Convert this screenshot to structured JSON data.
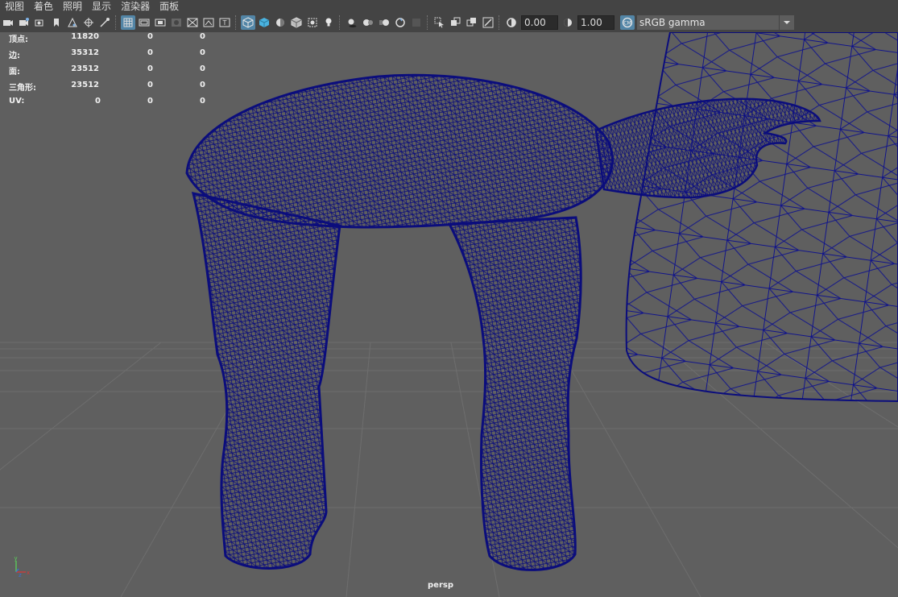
{
  "menus": [
    "视图",
    "着色",
    "照明",
    "显示",
    "渲染器",
    "面板"
  ],
  "toolbar": {
    "groups": [
      [
        "camera-icon",
        "camera-attributes-icon",
        "snapshot-icon",
        "bookmark-icon",
        "image-plane-icon",
        "camera-pivot-icon",
        "dolly-icon"
      ],
      [
        "grid-icon",
        "film-gate-icon",
        "resolution-gate-icon",
        "gate-mask-icon",
        "field-chart-icon",
        "safe-action-icon",
        "safe-title-icon"
      ],
      [
        "wireframe-icon",
        "smooth-shade-icon",
        "default-material-icon",
        "wireframe-on-shaded-icon",
        "xray-icon",
        "use-all-lights-icon"
      ],
      [
        "shadows-icon",
        "ambient-occlusion-icon",
        "motion-blur-icon",
        "multisample-antialias-icon",
        "depth-of-field-icon"
      ],
      [
        "isolate-select-icon",
        "xray-joints-icon",
        "xray-active-icon",
        "backface-culling-icon"
      ]
    ],
    "active": [
      "grid-icon",
      "wireframe-icon"
    ],
    "exposure": "0.00",
    "gamma": "1.00",
    "color_space": "sRGB gamma",
    "color_management_icon": "color-management-icon",
    "dropdown_icon": "chevron-down-icon"
  },
  "hud": {
    "rows": [
      {
        "label": "顶点:",
        "c1": "11820",
        "c2": "0",
        "c3": "0"
      },
      {
        "label": "边:",
        "c1": "35312",
        "c2": "0",
        "c3": "0"
      },
      {
        "label": "面:",
        "c1": "23512",
        "c2": "0",
        "c3": "0"
      },
      {
        "label": "三角形:",
        "c1": "23512",
        "c2": "0",
        "c3": "0"
      },
      {
        "label": "UV:",
        "c1": "0",
        "c2": "0",
        "c3": "0"
      }
    ]
  },
  "camera_label": "persp",
  "axes": {
    "y": "y",
    "x": "x",
    "z": "z"
  },
  "colors": {
    "viewport_bg": "#5f5f5f",
    "wireframe": "#0b0d7c",
    "grid": "#6e6e6e",
    "axis_x": "#d43a3a",
    "axis_y": "#5ad05a",
    "axis_z": "#3a6fd4",
    "active_button": "#5285a6"
  }
}
